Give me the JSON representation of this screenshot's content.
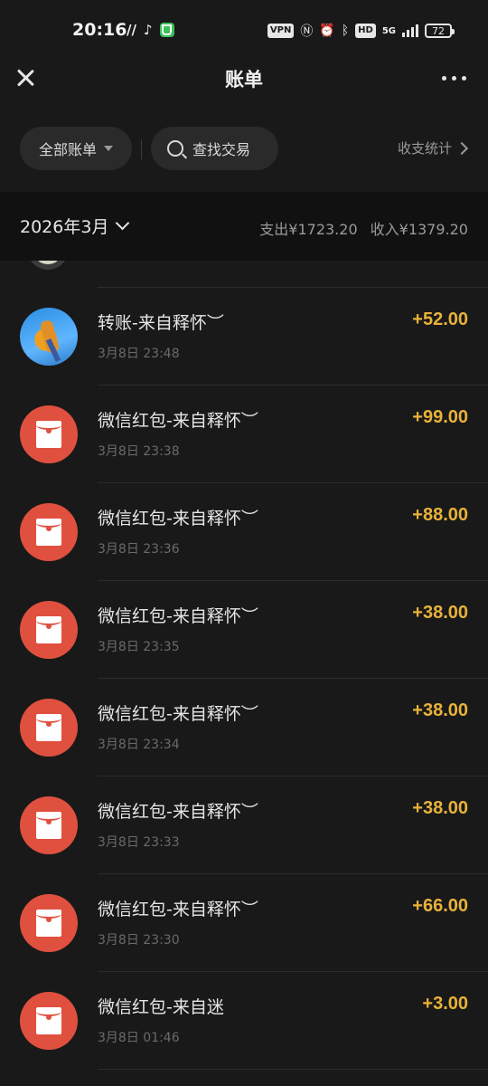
{
  "status_bar": {
    "time": "20:16",
    "vpn": "VPN",
    "hd": "HD",
    "network": "5G",
    "battery": "72"
  },
  "nav": {
    "title": "账单"
  },
  "filter": {
    "all_bills_label": "全部账单",
    "search_label": "查找交易",
    "stats_label": "收支统计"
  },
  "month": {
    "label": "2026年3月",
    "expense": "支出¥1723.20",
    "income": "收入¥1379.20"
  },
  "colors": {
    "amount": "#e8b23a",
    "redpacket": "#e0503f",
    "background": "#191919"
  },
  "transactions": [
    {
      "title": "转账-来自释怀︶",
      "time": "3月8日 23:48",
      "amount": "+52.00",
      "icon": "avatar-photo"
    },
    {
      "title": "微信红包-来自释怀︶",
      "time": "3月8日 23:38",
      "amount": "+99.00",
      "icon": "red-packet-icon"
    },
    {
      "title": "微信红包-来自释怀︶",
      "time": "3月8日 23:36",
      "amount": "+88.00",
      "icon": "red-packet-icon"
    },
    {
      "title": "微信红包-来自释怀︶",
      "time": "3月8日 23:35",
      "amount": "+38.00",
      "icon": "red-packet-icon"
    },
    {
      "title": "微信红包-来自释怀︶",
      "time": "3月8日 23:34",
      "amount": "+38.00",
      "icon": "red-packet-icon"
    },
    {
      "title": "微信红包-来自释怀︶",
      "time": "3月8日 23:33",
      "amount": "+38.00",
      "icon": "red-packet-icon"
    },
    {
      "title": "微信红包-来自释怀︶",
      "time": "3月8日 23:30",
      "amount": "+66.00",
      "icon": "red-packet-icon"
    },
    {
      "title": "微信红包-来自迷",
      "time": "3月8日 01:46",
      "amount": "+3.00",
      "icon": "red-packet-icon"
    }
  ]
}
